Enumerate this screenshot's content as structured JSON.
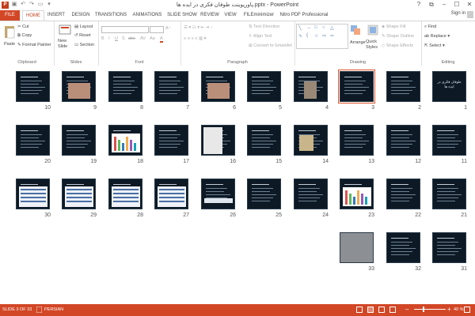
{
  "window": {
    "title": "پاورپوینت طوفان فکری در ایده ها.pptx - PowerPoint",
    "app_icon": "P",
    "controls": [
      "?",
      "⧉",
      "–",
      "☐",
      "✕"
    ]
  },
  "tabs": [
    "FILE",
    "HOME",
    "INSERT",
    "DESIGN",
    "TRANSITIONS",
    "ANIMATIONS",
    "SLIDE SHOW",
    "REVIEW",
    "VIEW",
    "FILEminimizer",
    "Nitro PDF Professional"
  ],
  "sign_in": "Sign in",
  "ribbon": {
    "clipboard": {
      "paste": "Paste",
      "cut": "Cut",
      "copy": "Copy",
      "format_painter": "Format Painter",
      "label": "Clipboard"
    },
    "slides": {
      "new_slide": "New Slide",
      "layout": "Layout",
      "reset": "Reset",
      "section": "Section",
      "label": "Slides"
    },
    "font": {
      "label": "Font",
      "buttons": [
        "B",
        "I",
        "U",
        "S",
        "abc",
        "AV",
        "Aa",
        "A"
      ]
    },
    "paragraph": {
      "label": "Paragraph",
      "text_direction": "Text Direction",
      "align_text": "Align Text",
      "convert_smartart": "Convert to SmartArt"
    },
    "drawing": {
      "label": "Drawing",
      "arrange": "Arrange",
      "quick_styles": "Quick Styles",
      "shape_fill": "Shape Fill",
      "shape_outline": "Shape Outline",
      "shape_effects": "Shape Effects"
    },
    "editing": {
      "label": "Editing",
      "find": "Find",
      "replace": "Replace",
      "select": "Select"
    }
  },
  "slides": [
    {
      "n": "1",
      "title": "طوفان فکری در ایده ها",
      "kind": "title"
    },
    {
      "n": "2",
      "kind": "text"
    },
    {
      "n": "3",
      "kind": "text",
      "selected": true
    },
    {
      "n": "4",
      "kind": "person"
    },
    {
      "n": "5",
      "kind": "text"
    },
    {
      "n": "6",
      "kind": "people"
    },
    {
      "n": "7",
      "kind": "text"
    },
    {
      "n": "8",
      "kind": "text"
    },
    {
      "n": "9",
      "kind": "people"
    },
    {
      "n": "10",
      "kind": "text"
    },
    {
      "n": "11",
      "kind": "text"
    },
    {
      "n": "12",
      "kind": "text"
    },
    {
      "n": "13",
      "kind": "text"
    },
    {
      "n": "14",
      "kind": "image"
    },
    {
      "n": "15",
      "kind": "text"
    },
    {
      "n": "16",
      "kind": "logo"
    },
    {
      "n": "17",
      "kind": "text"
    },
    {
      "n": "18",
      "kind": "chart"
    },
    {
      "n": "19",
      "kind": "text"
    },
    {
      "n": "20",
      "kind": "text"
    },
    {
      "n": "21",
      "kind": "text"
    },
    {
      "n": "22",
      "kind": "text"
    },
    {
      "n": "23",
      "kind": "chart"
    },
    {
      "n": "24",
      "kind": "text"
    },
    {
      "n": "25",
      "kind": "text"
    },
    {
      "n": "26",
      "kind": "strip"
    },
    {
      "n": "27",
      "kind": "table"
    },
    {
      "n": "28",
      "kind": "table"
    },
    {
      "n": "29",
      "kind": "table"
    },
    {
      "n": "30",
      "kind": "table"
    },
    {
      "n": "31",
      "kind": "text"
    },
    {
      "n": "32",
      "kind": "text"
    },
    {
      "n": "33",
      "kind": "photo"
    }
  ],
  "status": {
    "slide_info": "SLIDE 3 OF 33",
    "language": "PERSIAN",
    "zoom": "40 %"
  },
  "colors": {
    "accent": "#d24726",
    "slide_bg": "#0d1a26",
    "selected": "#e0542c"
  }
}
